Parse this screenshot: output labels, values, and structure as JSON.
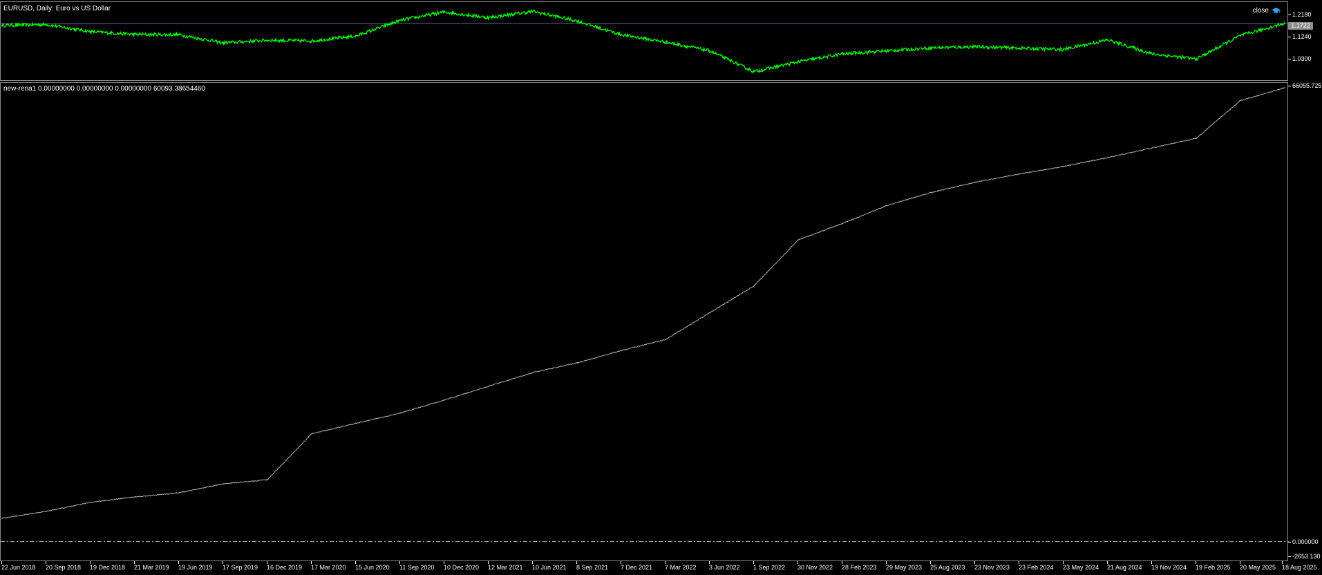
{
  "window": {
    "title": "EURUSD, Daily:  Euro vs US Dollar",
    "close_label": "close"
  },
  "price_pane": {
    "current_price": "1.1722",
    "axis_ticks": [
      "1.2180",
      "1.1240",
      "1.0300"
    ],
    "line_color": "#00ff00",
    "price_line_color": "#5a6e8c"
  },
  "indicator_pane": {
    "label": "new-rena1 0.00000000 0.00000000 0.00000000 60093.38654460",
    "axis_top": "66055.725",
    "axis_zero": "0.000000",
    "axis_bottom": "-2653.130",
    "line_color": "#b4b4b4",
    "zero_line_color": "#b4b4b4"
  },
  "x_axis": {
    "labels": [
      "22 Jun 2018",
      "20 Sep 2018",
      "19 Dec 2018",
      "21 Mar 2019",
      "19 Jun 2019",
      "17 Sep 2019",
      "16 Dec 2019",
      "17 Mar 2020",
      "15 Jun 2020",
      "11 Sep 2020",
      "10 Dec 2020",
      "12 Mar 2021",
      "10 Jun 2021",
      "8 Sep 2021",
      "7 Dec 2021",
      "7 Mar 2022",
      "3 Jun 2022",
      "1 Sep 2022",
      "30 Nov 2022",
      "28 Feb 2023",
      "29 May 2023",
      "25 Aug 2023",
      "23 Nov 2023",
      "23 Feb 2024",
      "23 May 2024",
      "21 Aug 2024",
      "19 Nov 2024",
      "19 Feb 2025",
      "20 May 2025",
      "18 Aug 2025"
    ]
  },
  "chart_data": [
    {
      "type": "line",
      "title": "EURUSD, Daily:  Euro vs US Dollar",
      "series": [
        {
          "name": "close",
          "x": [
            "22 Jun 2018",
            "20 Sep 2018",
            "19 Dec 2018",
            "21 Mar 2019",
            "19 Jun 2019",
            "17 Sep 2019",
            "16 Dec 2019",
            "17 Mar 2020",
            "15 Jun 2020",
            "11 Sep 2020",
            "10 Dec 2020",
            "12 Mar 2021",
            "10 Jun 2021",
            "8 Sep 2021",
            "7 Dec 2021",
            "7 Mar 2022",
            "3 Jun 2022",
            "1 Sep 2022",
            "30 Nov 2022",
            "28 Feb 2023",
            "29 May 2023",
            "25 Aug 2023",
            "23 Nov 2023",
            "23 Feb 2024",
            "23 May 2024",
            "21 Aug 2024",
            "19 Nov 2024",
            "19 Feb 2025",
            "20 May 2025",
            "18 Aug 2025"
          ],
          "values": [
            1.165,
            1.168,
            1.142,
            1.132,
            1.131,
            1.101,
            1.111,
            1.108,
            1.126,
            1.183,
            1.214,
            1.193,
            1.216,
            1.181,
            1.131,
            1.104,
            1.072,
            0.996,
            1.032,
            1.061,
            1.072,
            1.083,
            1.087,
            1.082,
            1.077,
            1.112,
            1.061,
            1.042,
            1.128,
            1.172
          ]
        }
      ],
      "ylim": [
        0.96,
        1.25
      ],
      "y_ticks": [
        1.218,
        1.124,
        1.03
      ]
    },
    {
      "type": "line",
      "title": "new-rena1",
      "series": [
        {
          "name": "new-rena1",
          "x": [
            "22 Jun 2018",
            "20 Sep 2018",
            "19 Dec 2018",
            "21 Mar 2019",
            "19 Jun 2019",
            "17 Sep 2019",
            "16 Dec 2019",
            "17 Mar 2020",
            "15 Jun 2020",
            "11 Sep 2020",
            "10 Dec 2020",
            "12 Mar 2021",
            "10 Jun 2021",
            "8 Sep 2021",
            "7 Dec 2021",
            "7 Mar 2022",
            "3 Jun 2022",
            "1 Sep 2022",
            "30 Nov 2022",
            "28 Feb 2023",
            "29 May 2023",
            "25 Aug 2023",
            "23 Nov 2023",
            "23 Feb 2024",
            "23 May 2024",
            "21 Aug 2024",
            "19 Nov 2024",
            "19 Feb 2025",
            "20 May 2025",
            "18 Aug 2025"
          ],
          "values": [
            3400,
            4400,
            5700,
            6500,
            7100,
            8400,
            9000,
            15700,
            17200,
            18700,
            20600,
            22600,
            24600,
            26000,
            27800,
            29400,
            33300,
            37200,
            43900,
            46300,
            48900,
            50800,
            52300,
            53500,
            54600,
            55900,
            57300,
            58700,
            64200,
            66055.725
          ]
        }
      ],
      "ylim": [
        -2653.13,
        66055.725
      ],
      "y_ticks": [
        66055.725,
        0,
        -2653.13
      ]
    }
  ]
}
